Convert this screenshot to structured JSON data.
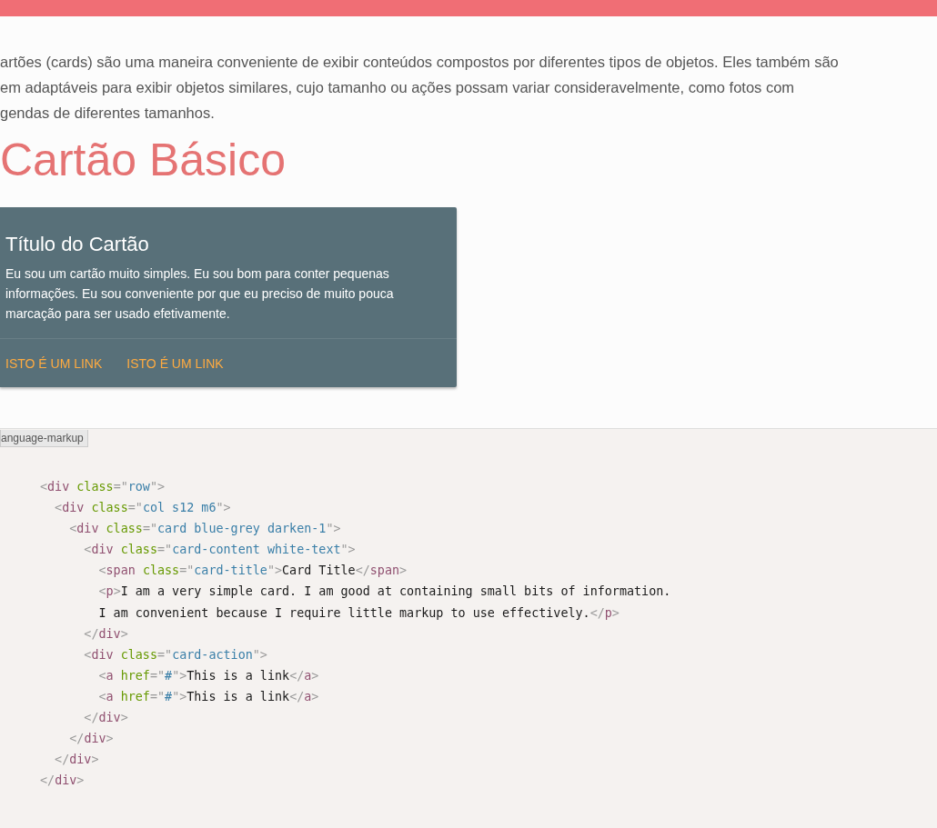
{
  "intro": {
    "lines": [
      "artões (cards) são uma maneira conveniente de exibir conteúdos compostos por diferentes tipos de objetos. Eles também são",
      "em adaptáveis para exibir objetos similares, cujo tamanho ou ações possam variar consideravelmente, como fotos com",
      "gendas de diferentes tamanhos."
    ]
  },
  "heading": "Cartão Básico",
  "card": {
    "title": "Título do Cartão",
    "text": "Eu sou um cartão muito simples. Eu sou bom para conter pequenas informações. Eu sou conveniente por que eu preciso de muito pouca marcação para ser usado efetivamente.",
    "links": [
      "ISTO É UM LINK",
      "ISTO É UM LINK"
    ]
  },
  "code": {
    "language": "anguage-markup",
    "lines": [
      [
        {
          "kind": "punct",
          "text": "<"
        },
        {
          "kind": "tag",
          "text": "div "
        },
        {
          "kind": "attr",
          "text": "class"
        },
        {
          "kind": "punct",
          "text": "=\""
        },
        {
          "kind": "value",
          "text": "row"
        },
        {
          "kind": "punct",
          "text": "\">"
        }
      ],
      [
        {
          "kind": "punct",
          "text": "  <"
        },
        {
          "kind": "tag",
          "text": "div "
        },
        {
          "kind": "attr",
          "text": "class"
        },
        {
          "kind": "punct",
          "text": "=\""
        },
        {
          "kind": "value",
          "text": "col s12 m6"
        },
        {
          "kind": "punct",
          "text": "\">"
        }
      ],
      [
        {
          "kind": "punct",
          "text": "    <"
        },
        {
          "kind": "tag",
          "text": "div "
        },
        {
          "kind": "attr",
          "text": "class"
        },
        {
          "kind": "punct",
          "text": "=\""
        },
        {
          "kind": "value",
          "text": "card blue-grey darken-1"
        },
        {
          "kind": "punct",
          "text": "\">"
        }
      ],
      [
        {
          "kind": "punct",
          "text": "      <"
        },
        {
          "kind": "tag",
          "text": "div "
        },
        {
          "kind": "attr",
          "text": "class"
        },
        {
          "kind": "punct",
          "text": "=\""
        },
        {
          "kind": "value",
          "text": "card-content white-text"
        },
        {
          "kind": "punct",
          "text": "\">"
        }
      ],
      [
        {
          "kind": "punct",
          "text": "        <"
        },
        {
          "kind": "tag",
          "text": "span "
        },
        {
          "kind": "attr",
          "text": "class"
        },
        {
          "kind": "punct",
          "text": "=\""
        },
        {
          "kind": "value",
          "text": "card-title"
        },
        {
          "kind": "punct",
          "text": "\">"
        },
        {
          "kind": "text",
          "text": "Card Title"
        },
        {
          "kind": "punct",
          "text": "</"
        },
        {
          "kind": "tag",
          "text": "span"
        },
        {
          "kind": "punct",
          "text": ">"
        }
      ],
      [
        {
          "kind": "punct",
          "text": "        <"
        },
        {
          "kind": "tag",
          "text": "p"
        },
        {
          "kind": "punct",
          "text": ">"
        },
        {
          "kind": "text",
          "text": "I am a very simple card. I am good at containing small bits of information."
        }
      ],
      [
        {
          "kind": "text",
          "text": "        I am convenient because I require little markup to use effectively."
        },
        {
          "kind": "punct",
          "text": "</"
        },
        {
          "kind": "tag",
          "text": "p"
        },
        {
          "kind": "punct",
          "text": ">"
        }
      ],
      [
        {
          "kind": "punct",
          "text": "      </"
        },
        {
          "kind": "tag",
          "text": "div"
        },
        {
          "kind": "punct",
          "text": ">"
        }
      ],
      [
        {
          "kind": "punct",
          "text": "      <"
        },
        {
          "kind": "tag",
          "text": "div "
        },
        {
          "kind": "attr",
          "text": "class"
        },
        {
          "kind": "punct",
          "text": "=\""
        },
        {
          "kind": "value",
          "text": "card-action"
        },
        {
          "kind": "punct",
          "text": "\">"
        }
      ],
      [
        {
          "kind": "punct",
          "text": "        <"
        },
        {
          "kind": "tag",
          "text": "a "
        },
        {
          "kind": "attr",
          "text": "href"
        },
        {
          "kind": "punct",
          "text": "=\""
        },
        {
          "kind": "value",
          "text": "#"
        },
        {
          "kind": "punct",
          "text": "\">"
        },
        {
          "kind": "text",
          "text": "This is a link"
        },
        {
          "kind": "punct",
          "text": "</"
        },
        {
          "kind": "tag",
          "text": "a"
        },
        {
          "kind": "punct",
          "text": ">"
        }
      ],
      [
        {
          "kind": "punct",
          "text": "        <"
        },
        {
          "kind": "tag",
          "text": "a "
        },
        {
          "kind": "attr",
          "text": "href"
        },
        {
          "kind": "punct",
          "text": "=\""
        },
        {
          "kind": "value",
          "text": "#"
        },
        {
          "kind": "punct",
          "text": "\">"
        },
        {
          "kind": "text",
          "text": "This is a link"
        },
        {
          "kind": "punct",
          "text": "</"
        },
        {
          "kind": "tag",
          "text": "a"
        },
        {
          "kind": "punct",
          "text": ">"
        }
      ],
      [
        {
          "kind": "punct",
          "text": "      </"
        },
        {
          "kind": "tag",
          "text": "div"
        },
        {
          "kind": "punct",
          "text": ">"
        }
      ],
      [
        {
          "kind": "punct",
          "text": "    </"
        },
        {
          "kind": "tag",
          "text": "div"
        },
        {
          "kind": "punct",
          "text": ">"
        }
      ],
      [
        {
          "kind": "punct",
          "text": "  </"
        },
        {
          "kind": "tag",
          "text": "div"
        },
        {
          "kind": "punct",
          "text": ">"
        }
      ],
      [
        {
          "kind": "punct",
          "text": "</"
        },
        {
          "kind": "tag",
          "text": "div"
        },
        {
          "kind": "punct",
          "text": ">"
        }
      ]
    ]
  }
}
